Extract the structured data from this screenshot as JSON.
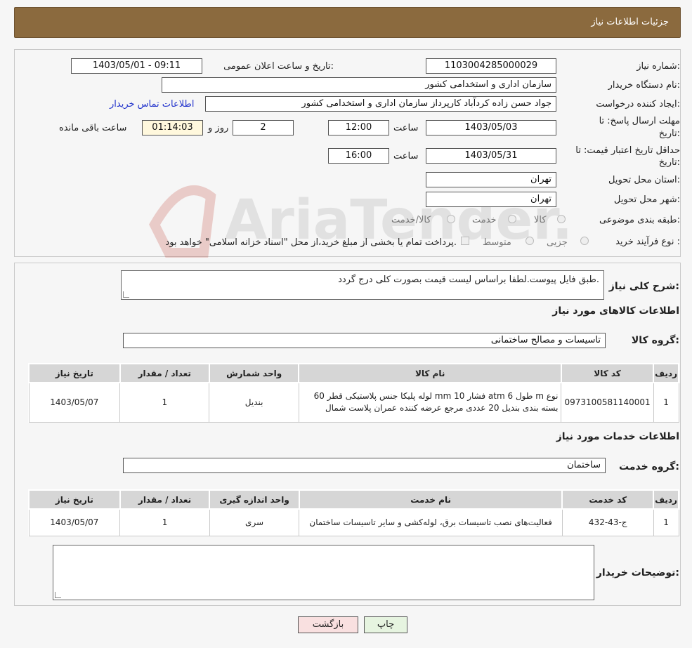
{
  "header": {
    "title": "جزئیات اطلاعات نیاز"
  },
  "watermark": {
    "text": "AriaTender.neT"
  },
  "details": {
    "need_number_label": "شماره نیاز:",
    "need_number": "1103004285000029",
    "announce_label": "تاریخ و ساعت اعلان عمومی:",
    "announce_value": "1403/05/01 - 09:11",
    "buyer_org_label": "نام دستگاه خریدار:",
    "buyer_org": "سازمان اداری و استخدامی کشور",
    "creator_label": "ایجاد کننده درخواست:",
    "creator": "جواد حسن زاده کردآباد کارپرداز سازمان اداری و استخدامی کشور",
    "contact_link": "اطلاعات تماس خریدار",
    "reply_deadline_label_1": "مهلت ارسال پاسخ: تا",
    "reply_deadline_label_2": "تاریخ:",
    "reply_date": "1403/05/03",
    "time_label": "ساعت",
    "reply_time": "12:00",
    "days_value": "2",
    "days_label": "روز و",
    "remaining_value": "01:14:03",
    "remaining_label": "ساعت باقی مانده",
    "validity_label_1": "حداقل تاریخ اعتبار قیمت: تا",
    "validity_label_2": "تاریخ:",
    "validity_date": "1403/05/31",
    "validity_time": "16:00",
    "province_label": "استان محل تحویل:",
    "province": "تهران",
    "city_label": "شهر محل تحویل:",
    "city": "تهران",
    "category_label": "طبقه بندی موضوعی:",
    "category_options": [
      "کالا",
      "خدمت",
      "کالا/خدمت"
    ],
    "purchase_type_label": "نوع فرآیند خرید :",
    "purchase_options": [
      "جزیی",
      "متوسط"
    ],
    "purchase_note": "پرداخت تمام یا بخشی از مبلغ خرید،از محل \"اسناد خزانه اسلامی\" خواهد بود."
  },
  "description": {
    "label": "شرح کلی نیاز:",
    "text": "طبق فایل پیوست.لطفا براساس لیست قیمت بصورت کلی درج گردد."
  },
  "goods": {
    "section_title": "اطلاعات کالاهای مورد نیاز",
    "group_label": "گروه کالا:",
    "group_value": "تاسیسات و مصالح ساختمانی",
    "headers": [
      "ردیف",
      "کد کالا",
      "نام کالا",
      "واحد شمارش",
      "تعداد / مقدار",
      "تاریخ نیاز"
    ],
    "rows": [
      {
        "row": "1",
        "code": "0973100581140001",
        "name": "لوله پلیکا جنس پلاستیکی قطر 60 mm فشار 10 atm طول 6 m نوع بسته بندی بندیل 20 عددی مرجع عرضه کننده عمران پلاست شمال",
        "unit": "بندیل",
        "qty": "1",
        "date": "1403/05/07"
      }
    ]
  },
  "services": {
    "section_title": "اطلاعات خدمات مورد نیاز",
    "group_label": "گروه خدمت:",
    "group_value": "ساختمان",
    "headers": [
      "ردیف",
      "کد خدمت",
      "نام خدمت",
      "واحد اندازه گیری",
      "تعداد / مقدار",
      "تاریخ نیاز"
    ],
    "rows": [
      {
        "row": "1",
        "code": "ج-43-432",
        "name": "فعالیت‌های نصب تاسیسات برق، لوله‌کشی و سایر تاسیسات ساختمان",
        "unit": "سری",
        "qty": "1",
        "date": "1403/05/07"
      }
    ]
  },
  "buyer_notes": {
    "label": "توضیحات خریدار:",
    "text": ""
  },
  "buttons": {
    "print": "چاپ",
    "back": "بازگشت"
  },
  "colors": {
    "header_bg": "#8b6a3e",
    "print_btn": "#e6f4e0",
    "back_btn": "#f9e0e0",
    "link": "#2233cc"
  }
}
